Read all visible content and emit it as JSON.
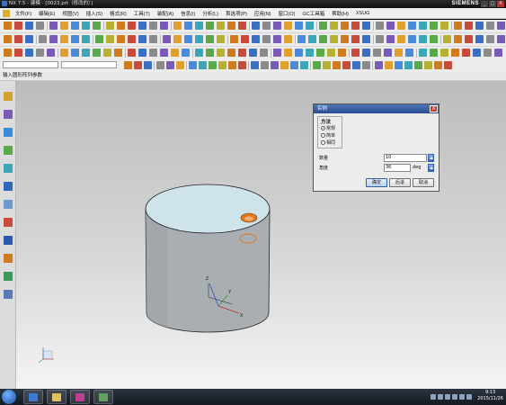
{
  "window": {
    "title": "NX 7.5 - 建模 - [0023.prt（修改的）]",
    "brand": "SIEMENS",
    "controls": {
      "minimize": "_",
      "maximize": "□",
      "close": "X"
    }
  },
  "menubar": {
    "items": [
      "文件(F)",
      "编辑(E)",
      "视图(V)",
      "插入(S)",
      "格式(R)",
      "工具(T)",
      "装配(A)",
      "信息(I)",
      "分析(L)",
      "首选项(P)",
      "应用(N)",
      "窗口(O)",
      "GC工具箱",
      "帮助(H)",
      "XSUG"
    ]
  },
  "selection_bar": {
    "type_filter": "",
    "scope": ""
  },
  "cue_line": "输入圆形阵列参数",
  "dialog": {
    "title": "实例",
    "close": "X",
    "method_group": "方法",
    "options": [
      "常规",
      "简单",
      "相同"
    ],
    "selected_option": "常规",
    "count_label": "数量",
    "count_value": "10",
    "angle_label": "角度",
    "angle_value": "36",
    "angle_unit": "deg",
    "ok": "确定",
    "back": "后退",
    "cancel": "取消"
  },
  "model": {
    "triad_labels": {
      "x": "X",
      "y": "Y",
      "z": "Z"
    }
  },
  "taskbar": {
    "time": "9:13",
    "date": "2015/11/26"
  },
  "colors": {
    "cylinder_body": "#a8aeb2",
    "cylinder_top": "#cfe3ea",
    "hole_highlight": "#e07a20",
    "dialog_title": "#284d90"
  }
}
